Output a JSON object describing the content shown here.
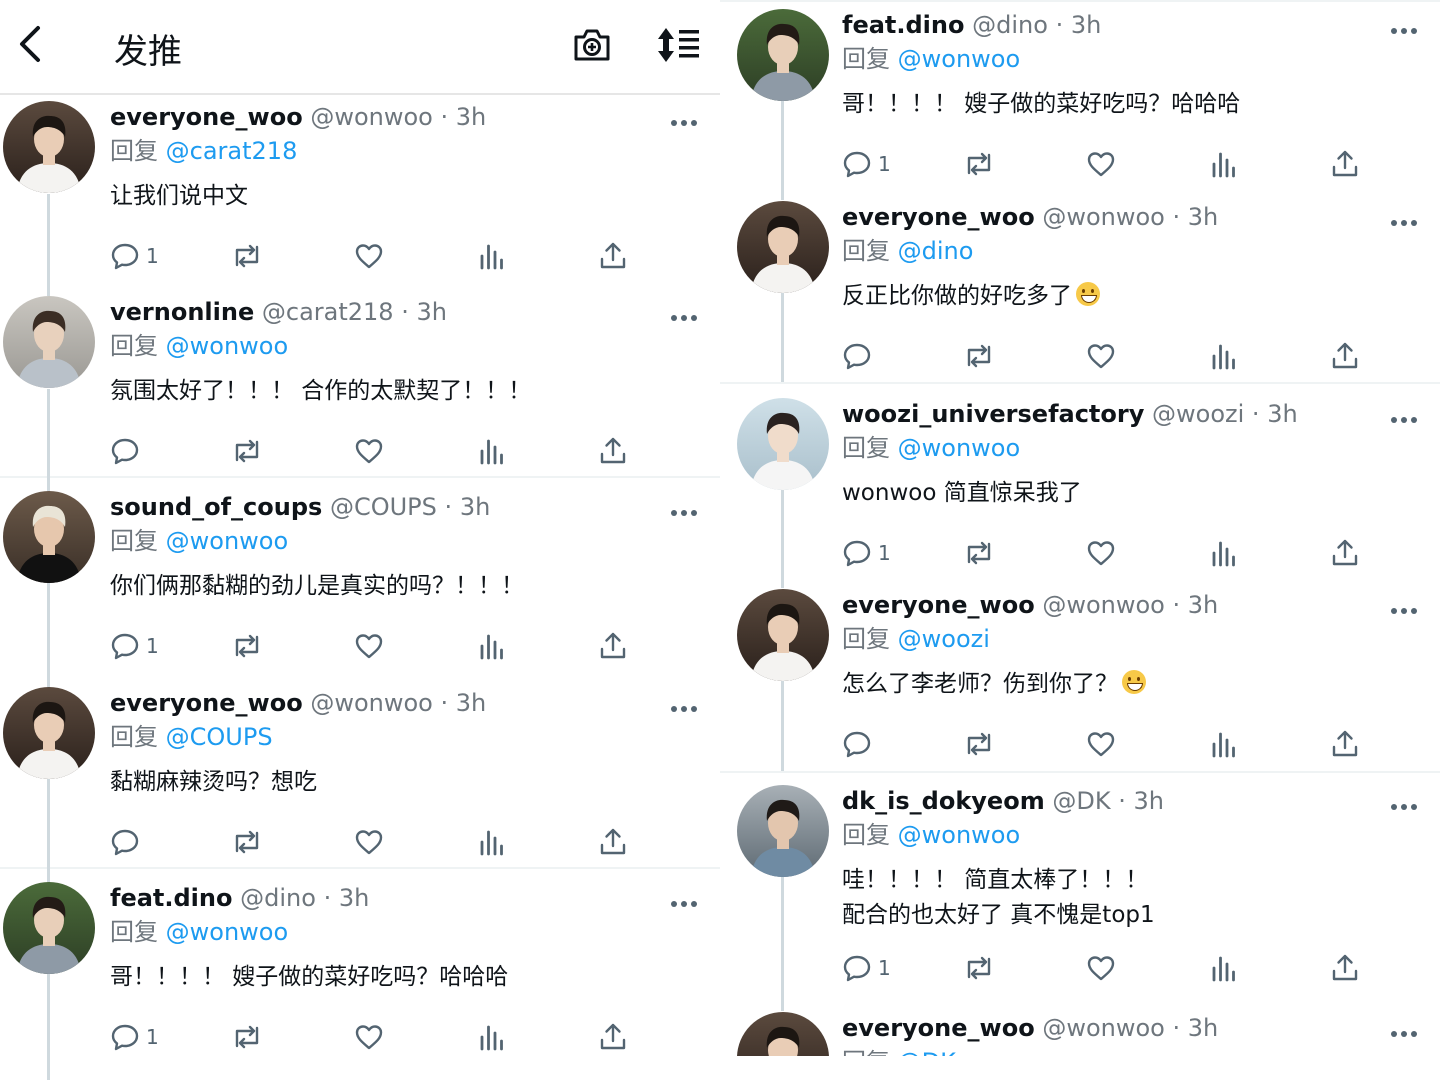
{
  "header": {
    "title": "发推"
  },
  "colors": {
    "link": "#1d9bf0",
    "secondary": "#6e767d",
    "divider": "#eff3f4",
    "thread_line": "#cfd9de"
  },
  "left_tweets": [
    {
      "name": "everyone_woo",
      "handle": "@wonwoo",
      "time": "3h",
      "reply_prefix": "回复",
      "reply_to": "@carat218",
      "text": "让我们说中文",
      "text2": "",
      "replies": "1"
    },
    {
      "name": "vernonline",
      "handle": "@carat218",
      "time": "3h",
      "reply_prefix": "回复",
      "reply_to": "@wonwoo",
      "text": "氛围太好了！！！ 合作的太默契了！！！",
      "text2": "",
      "replies": ""
    },
    {
      "name": "sound_of_coups",
      "handle": "@COUPS",
      "time": "3h",
      "reply_prefix": "回复",
      "reply_to": "@wonwoo",
      "text": "你们俩那黏糊的劲儿是真实的吗？！！！",
      "text2": "",
      "replies": "1"
    },
    {
      "name": "everyone_woo",
      "handle": "@wonwoo",
      "time": "3h",
      "reply_prefix": "回复",
      "reply_to": "@COUPS",
      "text": "黏糊麻辣烫吗？想吃",
      "text2": "",
      "replies": ""
    },
    {
      "name": "feat.dino",
      "handle": "@dino",
      "time": "3h",
      "reply_prefix": "回复",
      "reply_to": "@wonwoo",
      "text": "哥！！！！ 嫂子做的菜好吃吗？哈哈哈",
      "text2": "",
      "replies": "1"
    }
  ],
  "right_tweets": [
    {
      "name": "feat.dino",
      "handle": "@dino",
      "time": "3h",
      "reply_prefix": "回复",
      "reply_to": "@wonwoo",
      "text": "哥！！！！ 嫂子做的菜好吃吗？哈哈哈",
      "text2": "",
      "replies": "1"
    },
    {
      "name": "everyone_woo",
      "handle": "@wonwoo",
      "time": "3h",
      "reply_prefix": "回复",
      "reply_to": "@dino",
      "text": "反正比你做的好吃多了",
      "text2": "",
      "emoji": "grinning-face-emoji",
      "replies": ""
    },
    {
      "name": "woozi_universefactory",
      "handle": "@woozi",
      "time": "3h",
      "reply_prefix": "回复",
      "reply_to": "@wonwoo",
      "text": "wonwoo 简直惊呆我了",
      "text2": "",
      "replies": "1"
    },
    {
      "name": "everyone_woo",
      "handle": "@wonwoo",
      "time": "3h",
      "reply_prefix": "回复",
      "reply_to": "@woozi",
      "text": "怎么了李老师？伤到你了？",
      "text2": "",
      "emoji": "grinning-face-emoji",
      "replies": ""
    },
    {
      "name": "dk_is_dokyeom",
      "handle": "@DK",
      "time": "3h",
      "reply_prefix": "回复",
      "reply_to": "@wonwoo",
      "text": "哇！！！！ 简直太棒了！！！",
      "text2": "配合的也太好了 真不愧是top1",
      "replies": "1"
    },
    {
      "name": "everyone_woo",
      "handle": "@wonwoo",
      "time": "3h",
      "reply_prefix": "回复",
      "reply_to": "@DK",
      "text": "",
      "text2": "",
      "replies": ""
    }
  ]
}
